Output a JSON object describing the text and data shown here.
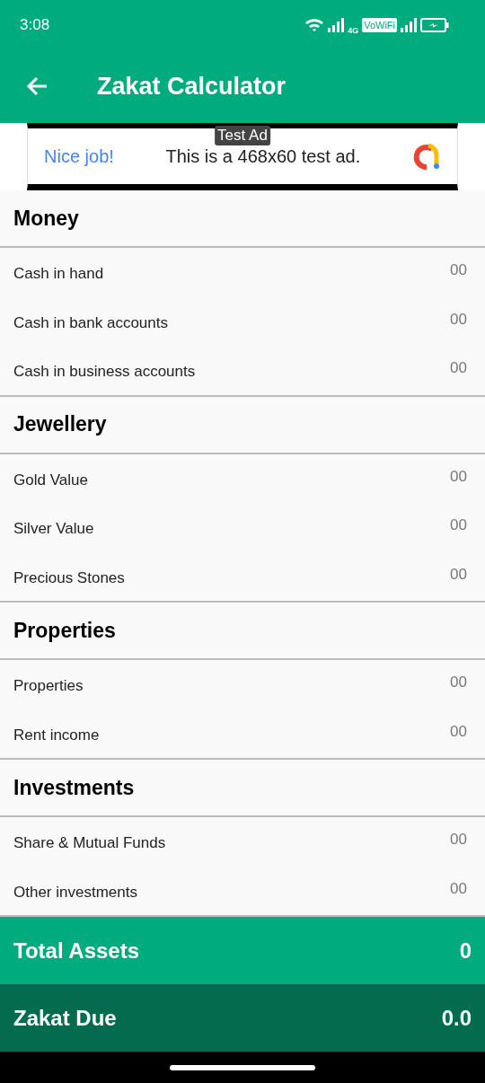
{
  "status_bar": {
    "time": "3:08",
    "network_badge": "4G",
    "wifi_calling": "VoWiFi"
  },
  "app_bar": {
    "title": "Zakat Calculator"
  },
  "ad": {
    "tag": "Test Ad",
    "headline": "Nice job!",
    "body": "This is a 468x60 test ad."
  },
  "sections": [
    {
      "title": "Money",
      "fields": [
        {
          "label": "Cash in hand",
          "placeholder": "00"
        },
        {
          "label": "Cash in bank accounts",
          "placeholder": "00"
        },
        {
          "label": "Cash in business accounts",
          "placeholder": "00"
        }
      ]
    },
    {
      "title": "Jewellery",
      "fields": [
        {
          "label": "Gold Value",
          "placeholder": "00"
        },
        {
          "label": "Silver Value",
          "placeholder": "00"
        },
        {
          "label": "Precious Stones",
          "placeholder": "00"
        }
      ]
    },
    {
      "title": "Properties",
      "fields": [
        {
          "label": "Properties",
          "placeholder": "00"
        },
        {
          "label": "Rent income",
          "placeholder": "00"
        }
      ]
    },
    {
      "title": "Investments",
      "fields": [
        {
          "label": "Share & Mutual Funds",
          "placeholder": "00"
        },
        {
          "label": "Other investments",
          "placeholder": "00"
        }
      ]
    }
  ],
  "totals": [
    {
      "kind": "assets",
      "label": "Total Assets",
      "value": "0"
    },
    {
      "kind": "due",
      "label": "Zakat Due",
      "value": "0.0"
    }
  ]
}
